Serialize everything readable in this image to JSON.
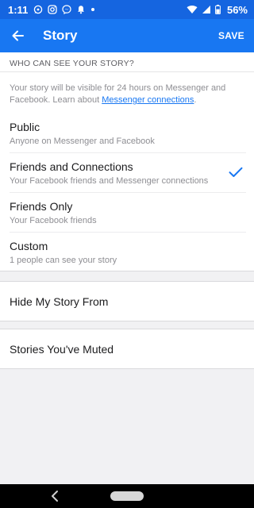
{
  "status_bar": {
    "time": "1:11",
    "battery": "56%",
    "icons": [
      "whatsapp-icon",
      "instagram-icon",
      "messenger-icon",
      "notification-bell-icon",
      "dot-icon",
      "wifi-icon",
      "signal-icon",
      "battery-icon"
    ]
  },
  "app_bar": {
    "title": "Story",
    "save_label": "SAVE",
    "back_icon": "arrow-left-icon",
    "color": "#1877f2"
  },
  "visibility": {
    "header": "WHO CAN SEE YOUR STORY?",
    "description_prefix": "Your story will be visible for 24 hours on Messenger and Facebook. Learn about ",
    "description_link": "Messenger connections",
    "description_suffix": ".",
    "options": [
      {
        "title": "Public",
        "subtitle": "Anyone on Messenger and Facebook",
        "selected": false
      },
      {
        "title": "Friends and Connections",
        "subtitle": "Your Facebook friends and Messenger connections",
        "selected": true
      },
      {
        "title": "Friends Only",
        "subtitle": "Your Facebook friends",
        "selected": false
      },
      {
        "title": "Custom",
        "subtitle": "1 people can see your story",
        "selected": false
      }
    ]
  },
  "rows": {
    "hide_story": "Hide My Story From",
    "muted_stories": "Stories You've Muted"
  }
}
